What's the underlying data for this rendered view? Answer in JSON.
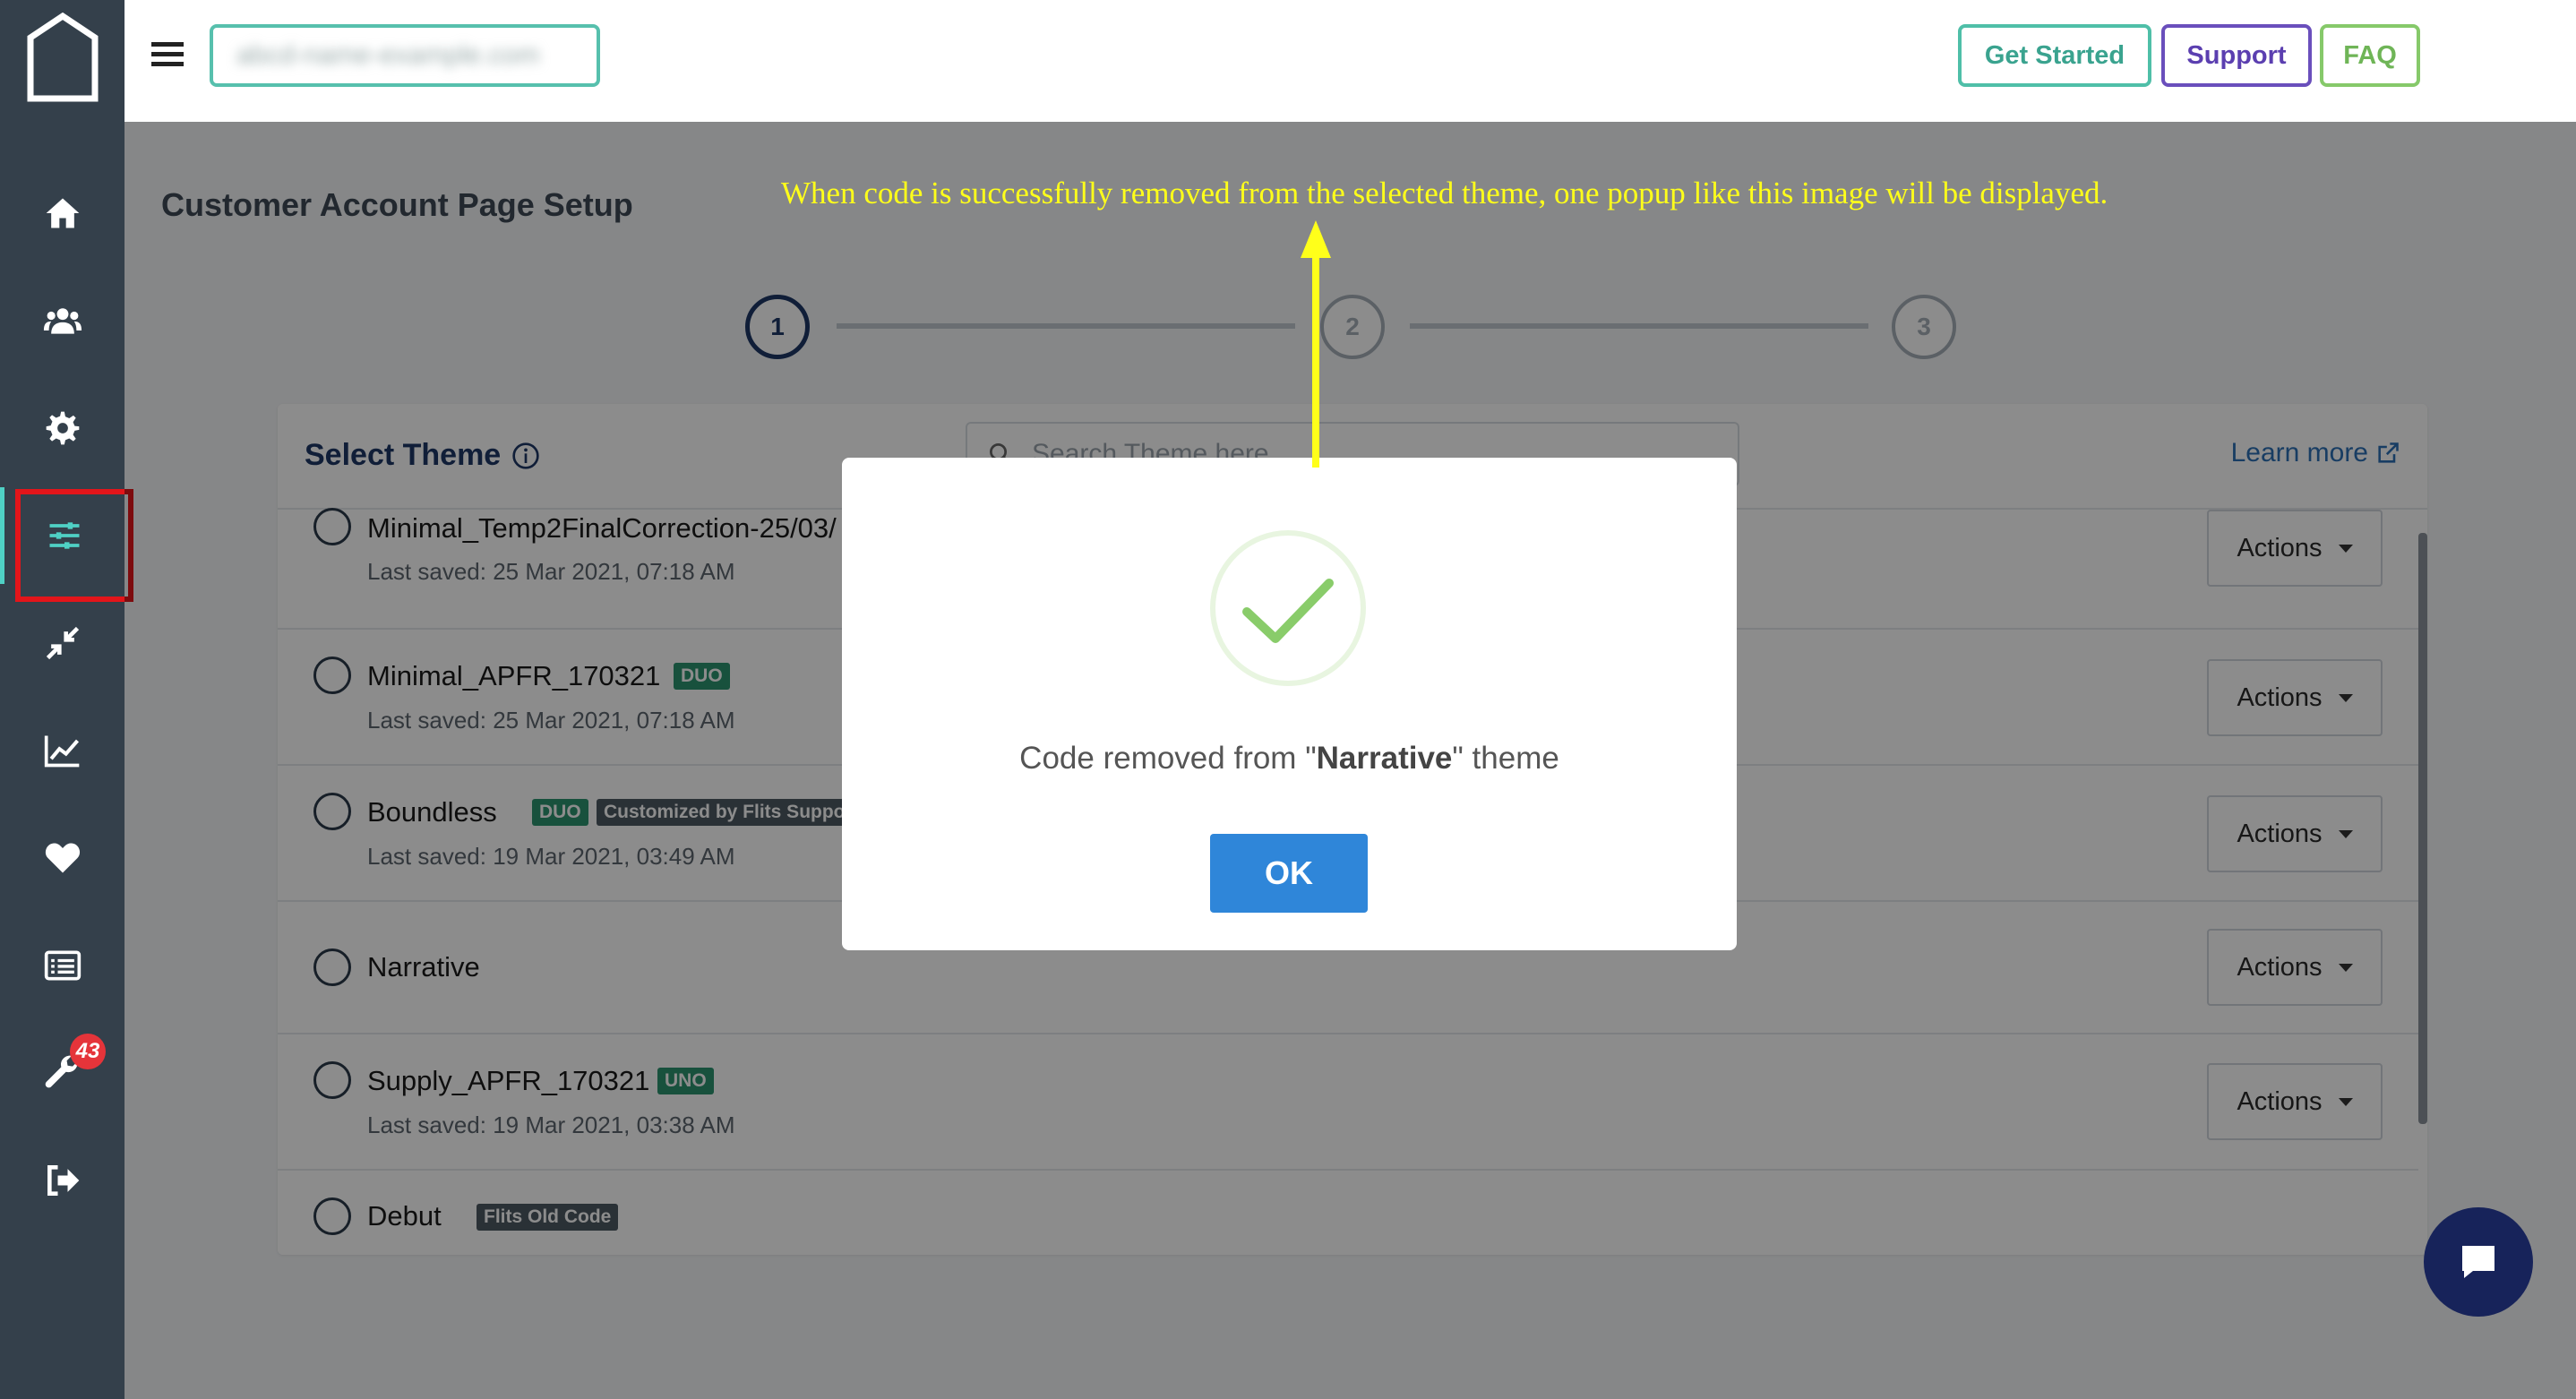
{
  "topbar": {
    "store_name": "abcd-name-example.com",
    "get_started": "Get Started",
    "support": "Support",
    "faq": "FAQ"
  },
  "sidebar": {
    "items": [
      {
        "icon": "home-icon"
      },
      {
        "icon": "users-icon"
      },
      {
        "icon": "gear-icon"
      },
      {
        "icon": "sliders-icon",
        "active": true
      },
      {
        "icon": "compress-icon"
      },
      {
        "icon": "chart-line-icon"
      },
      {
        "icon": "heart-icon"
      },
      {
        "icon": "list-icon"
      },
      {
        "icon": "wrench-icon",
        "badge": "43"
      },
      {
        "icon": "logout-icon"
      }
    ]
  },
  "page": {
    "title": "Customer Account Page Setup"
  },
  "stepper": {
    "steps": [
      "1",
      "2",
      "3"
    ],
    "active": 1
  },
  "card": {
    "title": "Select Theme",
    "search_placeholder": "Search Theme here",
    "learn_more": "Learn more"
  },
  "themes": [
    {
      "name": "Minimal_Temp2FinalCorrection-25/03/",
      "saved": "Last saved: 25 Mar 2021, 07:18 AM",
      "tags": [],
      "actions": "Actions"
    },
    {
      "name": "Minimal_APFR_170321",
      "saved": "Last saved: 25 Mar 2021, 07:18 AM",
      "tags": [
        "DUO"
      ],
      "actions": "Actions"
    },
    {
      "name": "Boundless",
      "saved": "Last saved: 19 Mar 2021, 03:49 AM",
      "tags": [
        "DUO",
        "Customized by Flits Suppo"
      ],
      "actions": "Actions"
    },
    {
      "name": "Narrative",
      "saved": "",
      "tags": [],
      "actions": "Actions"
    },
    {
      "name": "Supply_APFR_170321",
      "saved": "Last saved: 19 Mar 2021, 03:38 AM",
      "tags": [
        "UNO"
      ],
      "actions": "Actions"
    },
    {
      "name": "Debut",
      "saved": "",
      "tags": [
        "Flits Old Code"
      ],
      "actions": ""
    }
  ],
  "modal": {
    "msg_prefix": "Code removed from \"",
    "theme": "Narrative",
    "msg_suffix": "\" theme",
    "ok": "OK"
  },
  "annotation": "When code is successfully removed from the selected theme, one popup like this image will be displayed.",
  "colors": {
    "sidebar": "#34404b",
    "accent_teal": "#4fbfa8",
    "accent_purple": "#5b3fb0",
    "accent_green": "#6fb557",
    "ok_blue": "#2f86d9",
    "annotation_yellow": "#ffff1a",
    "highlight_red": "#e3151a"
  }
}
